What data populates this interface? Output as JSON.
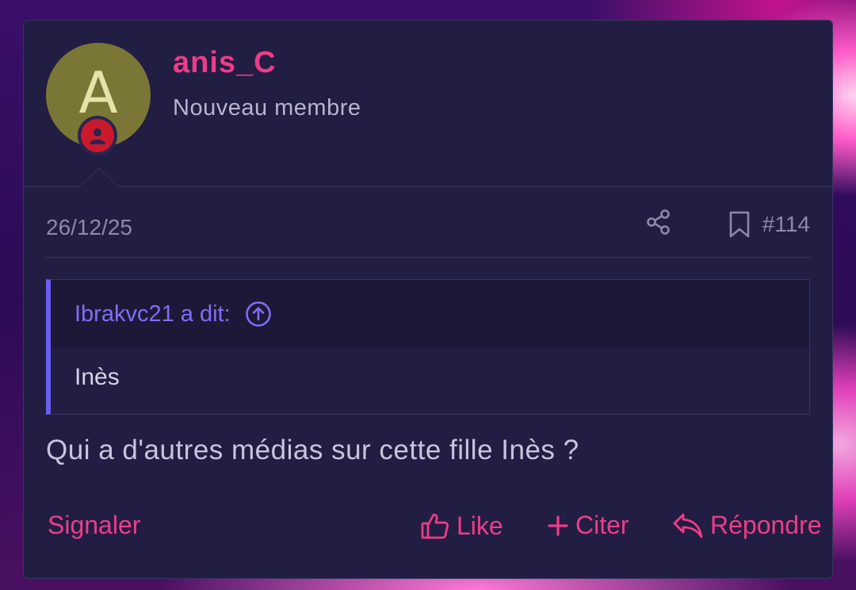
{
  "post": {
    "username": "anis_C",
    "user_title": "Nouveau membre",
    "avatar_letter": "A",
    "date": "26/12/25",
    "post_number": "#114",
    "quote": {
      "author_line": "Ibrakvc21 a dit:",
      "text": "Inès"
    },
    "message": "Qui a d'autres médias sur cette fille Inès ?"
  },
  "actions": {
    "report": "Signaler",
    "like": "Like",
    "quote": "Citer",
    "reply": "Répondre"
  },
  "icons": {
    "share": "share-icon",
    "bookmark": "bookmark-icon",
    "quote_jump": "arrow-up-circle-icon",
    "like": "thumbs-up-icon",
    "quote": "plus-icon",
    "reply": "reply-icon",
    "badge": "user-icon"
  },
  "colors": {
    "accent": "#ec3d8a",
    "quote_accent": "#6a5df0",
    "card_bg": "#221d42",
    "avatar_bg": "#7a7636",
    "badge_bg": "#c81a2a"
  }
}
